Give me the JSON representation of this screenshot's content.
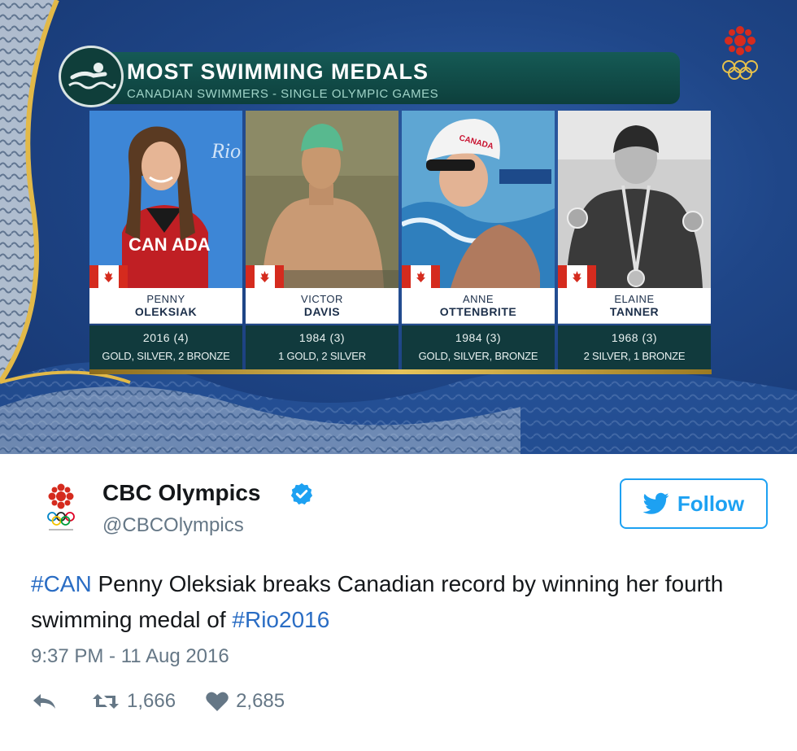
{
  "graphic": {
    "title": "MOST SWIMMING MEDALS",
    "subtitle": "CANADIAN SWIMMERS  -  SINGLE OLYMPIC GAMES",
    "athletes": [
      {
        "first": "PENNY",
        "last": "OLEKSIAK",
        "year": "2016  (4)",
        "medals": "GOLD, SILVER, 2 BRONZE",
        "jacket_text": "CAN ADA",
        "backdrop_text": "Rio"
      },
      {
        "first": "VICTOR",
        "last": "DAVIS",
        "year": "1984  (3)",
        "medals": "1 GOLD, 2 SILVER"
      },
      {
        "first": "ANNE",
        "last": "OTTENBRITE",
        "year": "1984  (3)",
        "medals": "GOLD, SILVER, BRONZE",
        "cap_text": "CANADA"
      },
      {
        "first": "ELAINE",
        "last": "TANNER",
        "year": "1968  (3)",
        "medals": "2 SILVER, 1 BRONZE"
      }
    ]
  },
  "tweet": {
    "display_name": "CBC Olympics",
    "handle": "@CBCOlympics",
    "follow_label": "Follow",
    "text_tag_1": "#CAN",
    "text_main": " Penny Oleksiak breaks Canadian record by winning her fourth swimming medal of ",
    "text_tag_2": "#Rio2016",
    "timestamp": "9:37 PM - 11 Aug 2016",
    "retweets": "1,666",
    "likes": "2,685"
  },
  "icons": {
    "reply": "reply-icon",
    "retweet": "retweet-icon",
    "like": "heart-icon",
    "verified": "verified-badge-icon",
    "follow": "twitter-bird-icon"
  },
  "colors": {
    "accent": "#1da1f2",
    "hashtag": "#2a6dc4",
    "muted": "#657786",
    "graphic_bg": "#1f4688",
    "panel_teal": "#113a3d",
    "cbc_red": "#d52b1e"
  }
}
